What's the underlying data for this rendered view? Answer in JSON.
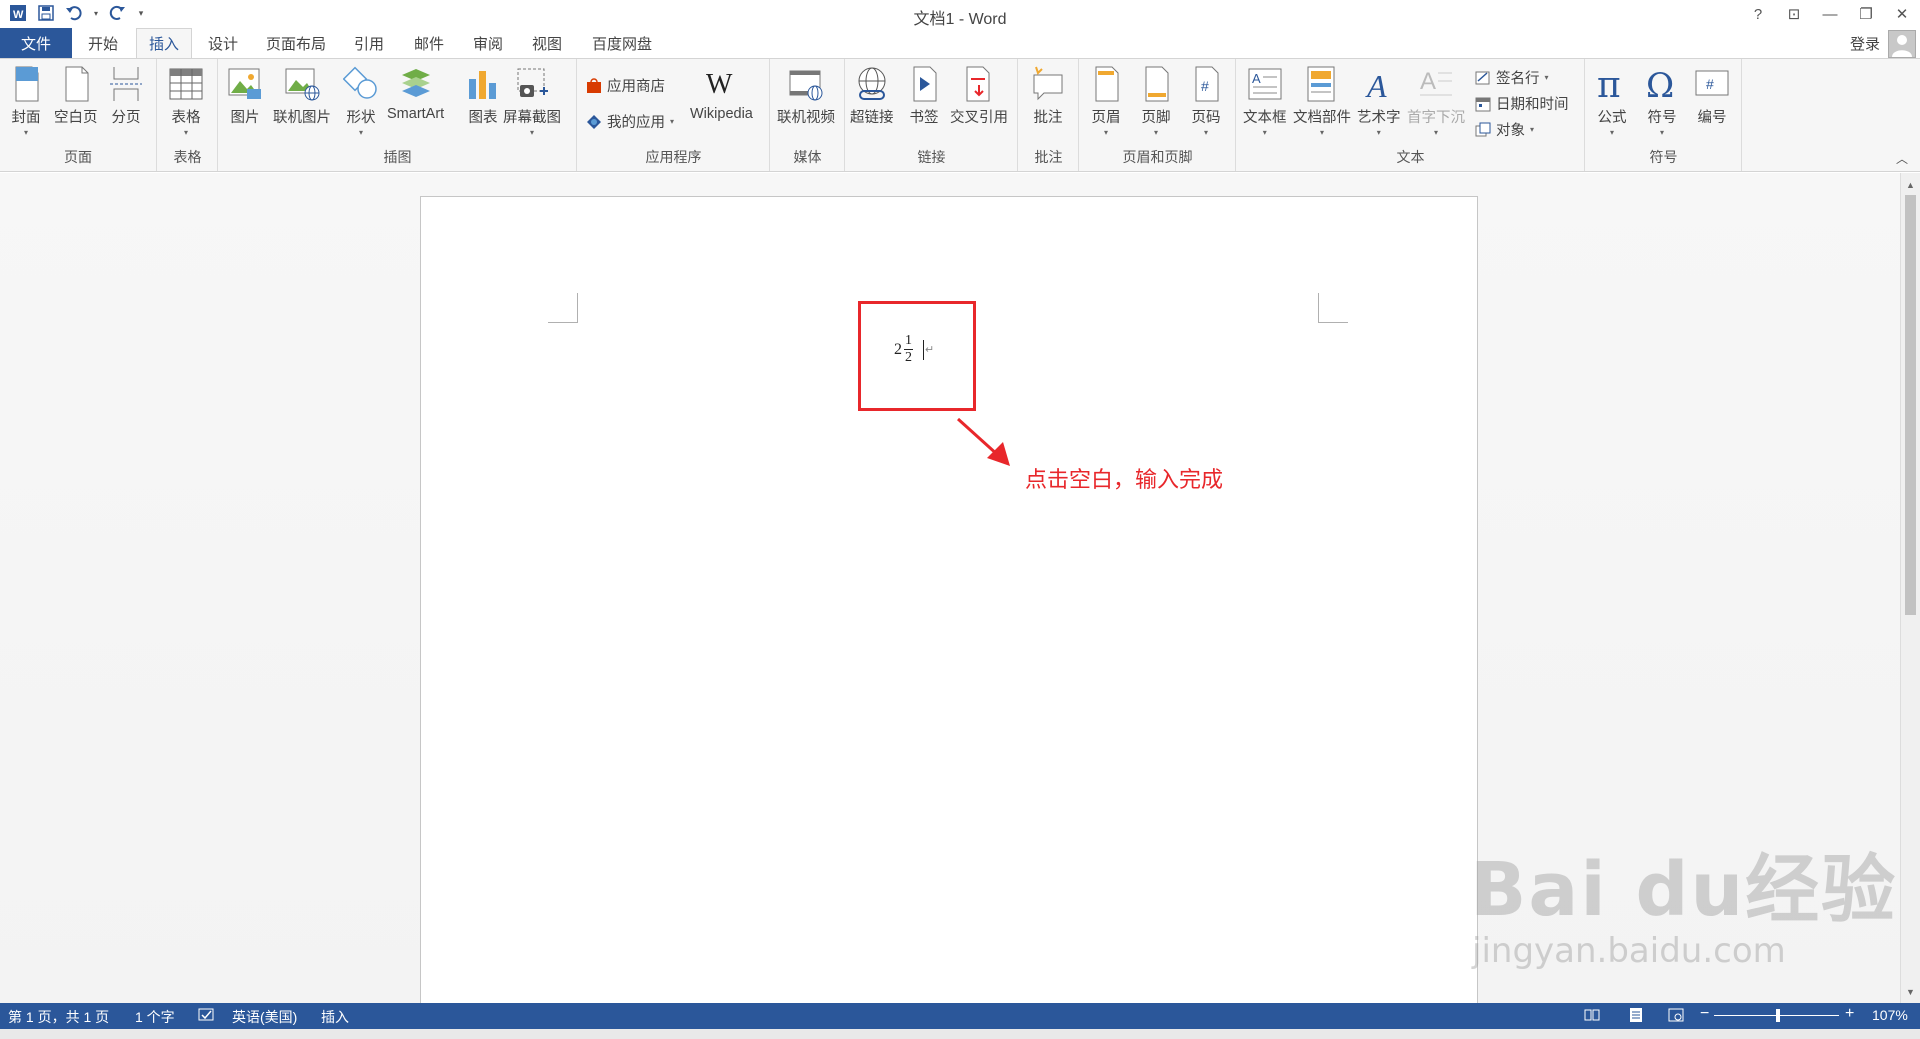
{
  "window": {
    "title": "文档1 - Word",
    "login_label": "登录",
    "help": "?",
    "ribbon_display": "⊡",
    "minimize": "—",
    "restore": "❐",
    "close": "✕"
  },
  "tabs": {
    "file": "文件",
    "items": [
      "开始",
      "插入",
      "设计",
      "页面布局",
      "引用",
      "邮件",
      "审阅",
      "视图",
      "百度网盘"
    ],
    "active": "插入"
  },
  "ribbon": {
    "groups": {
      "page": "页面",
      "table": "表格",
      "illustrations": "插图",
      "apps": "应用程序",
      "media": "媒体",
      "links": "链接",
      "comments": "批注",
      "header_footer": "页眉和页脚",
      "text": "文本",
      "symbols": "符号"
    },
    "buttons": {
      "cover": "封面",
      "blank_page": "空白页",
      "page_break": "分页",
      "table": "表格",
      "pictures": "图片",
      "online_pictures": "联机图片",
      "shapes": "形状",
      "smartart": "SmartArt",
      "chart": "图表",
      "screenshot": "屏幕截图",
      "store": "应用商店",
      "my_apps": "我的应用",
      "wikipedia": "Wikipedia",
      "online_video": "联机视频",
      "hyperlink": "超链接",
      "bookmark": "书签",
      "cross_reference": "交叉引用",
      "comment": "批注",
      "header": "页眉",
      "footer": "页脚",
      "page_number": "页码",
      "text_box": "文本框",
      "quick_parts": "文档部件",
      "wordart": "艺术字",
      "drop_cap": "首字下沉",
      "signature_line": "签名行",
      "date_time": "日期和时间",
      "object": "对象",
      "equation": "公式",
      "symbol": "符号",
      "numbering": "编号"
    }
  },
  "document": {
    "math": {
      "whole": "2",
      "numerator": "1",
      "denominator": "2"
    },
    "annotation": "点击空白，输入完成"
  },
  "watermark": {
    "line1": "Bai du经验",
    "line2": "jingyan.baidu.com"
  },
  "statusbar": {
    "page": "第 1 页，共 1 页",
    "words": "1 个字",
    "language": "英语(美国)",
    "mode": "插入",
    "zoom": "107%"
  },
  "colors": {
    "accent": "#2b579a",
    "annotation_red": "#e8272b"
  }
}
